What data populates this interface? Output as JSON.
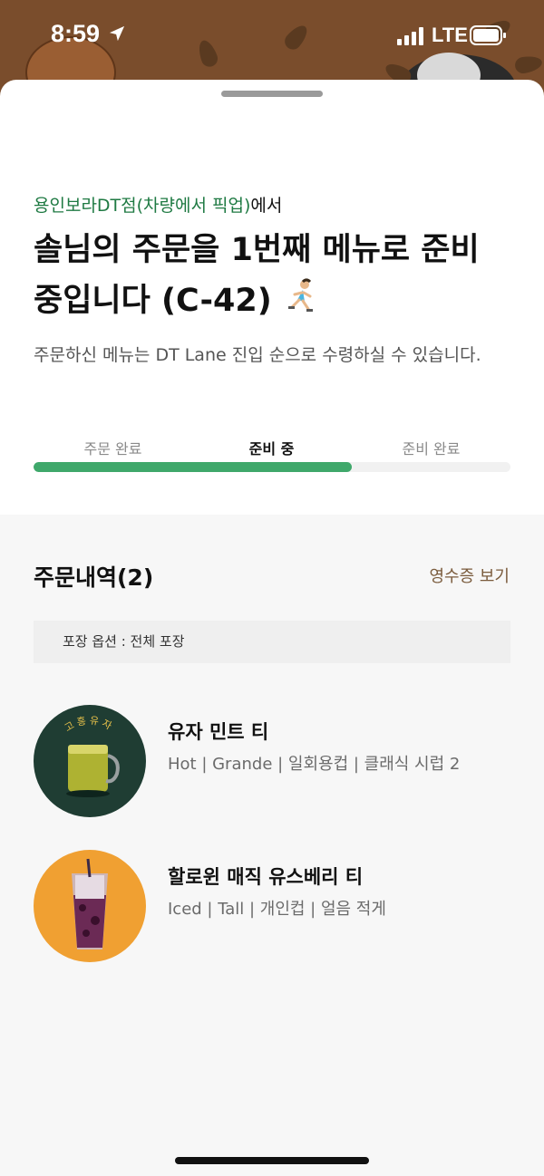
{
  "status_bar": {
    "time": "8:59",
    "network": "LTE",
    "icons": [
      "location-arrow-icon",
      "signal-icon",
      "battery-icon"
    ]
  },
  "header": {
    "store_name": "용인보라DT점(차량에서 픽업)",
    "store_suffix": "에서",
    "headline": "솔님의 주문을 1번째 메뉴로 준비 중입니다 (C-42)",
    "headline_icon": "runner-icon",
    "subtext": "주문하신 메뉴는 DT Lane 진입 순으로 수령하실 수 있습니다."
  },
  "progress": {
    "steps": [
      {
        "label": "주문 완료"
      },
      {
        "label": "준비 중"
      },
      {
        "label": "준비 완료"
      }
    ],
    "active_step": 1,
    "fill_fraction": 0.667,
    "fill_color": "#3fa86b"
  },
  "order": {
    "title": "주문내역(2)",
    "receipt_link": "영수증 보기",
    "option_text": "포장 옵션 : 전체 포장",
    "items": [
      {
        "name": "유자 민트 티",
        "detail": "Hot | Grande | 일회용컵 | 클래식 시럽 2",
        "image_label": "고흥유자",
        "image_bg": "#1f3d33"
      },
      {
        "name": "할로윈 매직 유스베리 티",
        "detail": "Iced | Tall | 개인컵 | 얼음 적게",
        "image_bg": "#f0a032"
      }
    ]
  },
  "colors": {
    "brand_green": "#1f7a43",
    "link_brown": "#7a5b3c",
    "header_brown": "#7a4d2c"
  }
}
